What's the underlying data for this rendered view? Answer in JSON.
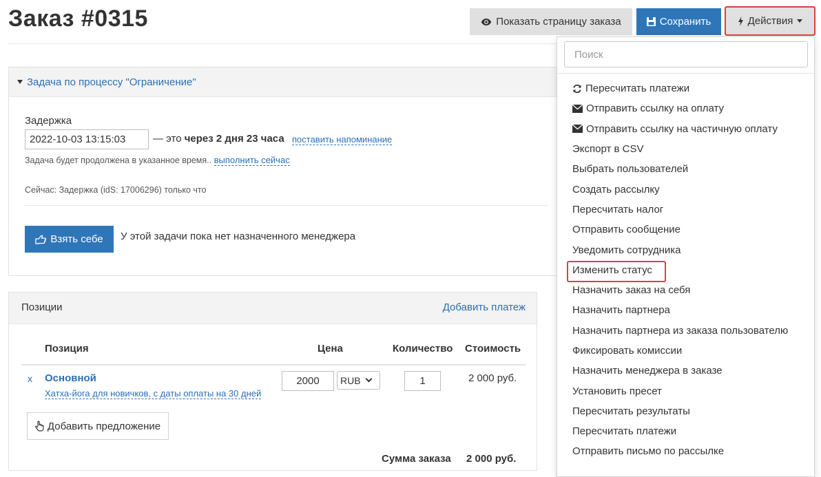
{
  "page": {
    "title": "Заказ #0315"
  },
  "toolbar": {
    "show_label": "Показать страницу заказа",
    "save_label": "Сохранить",
    "actions_label": "Действия",
    "accent": "#2f76b9",
    "highlight": "#d9413a"
  },
  "task": {
    "header": "Задача по процессу \"Ограничение\"",
    "delay_label": "Задержка",
    "delay_value": "2022-10-03 13:15:03",
    "delay_prefix": "— это",
    "delay_bold": "через 2 дня 23 часа",
    "remind_link": "поставить напоминание",
    "note_text": "Задача будет продолжена в указанное время..",
    "run_now_link": "выполнить сейчас",
    "now_text": "Сейчас: Задержка (idS: 17006296) только что",
    "take_button": "Взять себе",
    "no_manager": "У этой задачи пока нет назначенного менеджера"
  },
  "positions": {
    "title": "Позиции",
    "add_payment": "Добавить платеж",
    "columns": [
      "Позиция",
      "Цена",
      "Количество",
      "Стоимость"
    ],
    "item": {
      "remove": "x",
      "name": "Основной",
      "subtitle": "Хатха-йога для новичков, с даты оплаты на 30 дней",
      "price": "2000",
      "currency": "RUB",
      "quantity": "1",
      "cost": "2 000 руб."
    },
    "add_offer": "Добавить предложение",
    "total_label": "Сумма заказа",
    "total_value": "2 000 руб."
  },
  "dropdown": {
    "search_placeholder": "Поиск",
    "items": [
      {
        "label": "Пересчитать платежи",
        "icon": "refresh-icon"
      },
      {
        "label": "Отправить ссылку на оплату",
        "icon": "envelope-icon"
      },
      {
        "label": "Отправить ссылку на частичную оплату",
        "icon": "envelope-icon"
      },
      {
        "label": "Экспорт в CSV"
      },
      {
        "label": "Выбрать пользователей"
      },
      {
        "label": "Создать рассылку"
      },
      {
        "label": "Пересчитать налог"
      },
      {
        "label": "Отправить сообщение"
      },
      {
        "label": "Уведомить сотрудника"
      },
      {
        "label": "Изменить статус",
        "highlighted": true
      },
      {
        "label": "Назначить заказ на себя"
      },
      {
        "label": "Назначить партнера"
      },
      {
        "label": "Назначить партнера из заказа пользователю"
      },
      {
        "label": "Фиксировать комиссии"
      },
      {
        "label": "Назначить менеджера в заказе"
      },
      {
        "label": "Установить пресет"
      },
      {
        "label": "Пересчитать результаты"
      },
      {
        "label": "Пересчитать платежи"
      },
      {
        "label": "Отправить письмо по рассылке"
      }
    ]
  }
}
